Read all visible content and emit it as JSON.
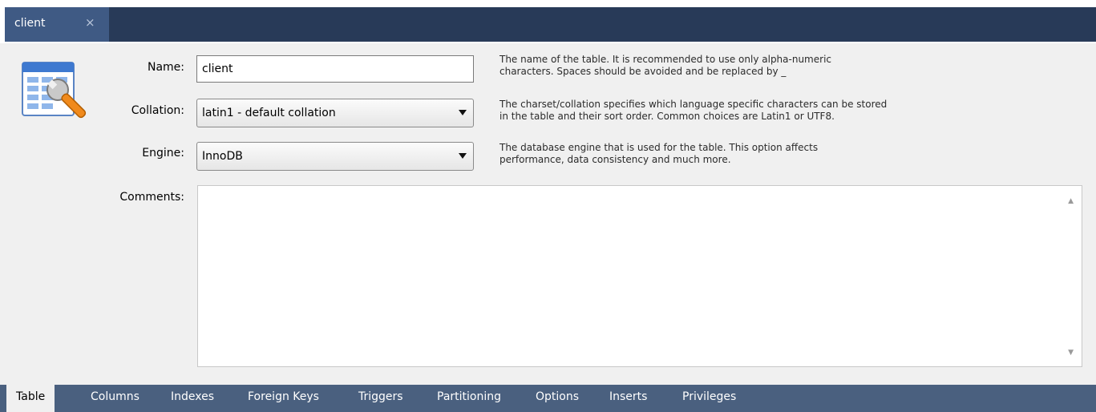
{
  "document_tab": {
    "label": "client",
    "close_glyph": "×"
  },
  "icon": {
    "name": "table-settings-icon"
  },
  "form": {
    "name": {
      "label": "Name:",
      "value": "client"
    },
    "collation": {
      "label": "Collation:",
      "value": "latin1 - default collation"
    },
    "engine": {
      "label": "Engine:",
      "value": "InnoDB"
    },
    "comments": {
      "label": "Comments:",
      "value": ""
    }
  },
  "descriptions": {
    "name": [
      "The name of the table. It is recommended to use only alpha-numeric",
      "characters. Spaces should be avoided and be replaced by _"
    ],
    "collation": [
      "The charset/collation specifies which language specific characters can be stored",
      "in the table and their sort order. Common choices are Latin1 or UTF8."
    ],
    "engine": [
      "The database engine that is used for the table. This option affects",
      "performance, data consistency and much more."
    ]
  },
  "bottom_tabs": [
    "Table",
    "Columns",
    "Indexes",
    "Foreign Keys",
    "Triggers",
    "Partitioning",
    "Options",
    "Inserts",
    "Privileges"
  ],
  "colors": {
    "tab_strip": "#283a58",
    "active_doc_tab": "#3f5a84",
    "bottom_bar": "#4a607f",
    "panel": "#f0f0f0"
  }
}
